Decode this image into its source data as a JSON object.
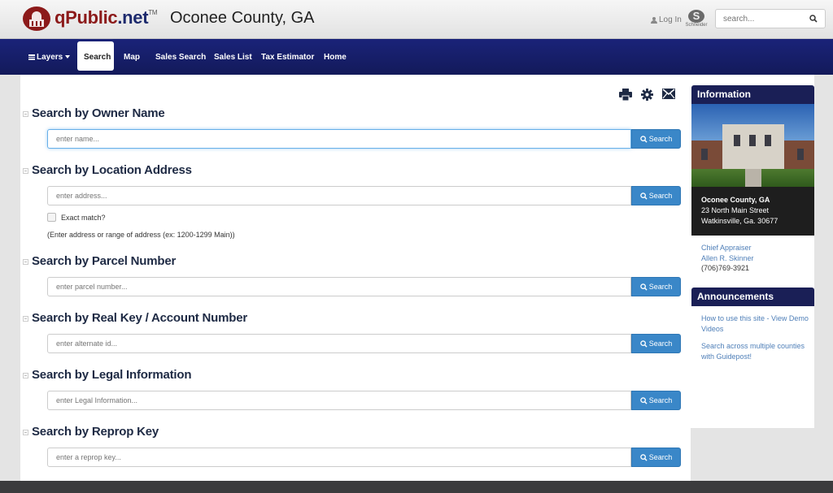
{
  "header": {
    "brand_main": "qPublic",
    "brand_ext": ".net",
    "brand_tm": "TM",
    "county": "Oconee County, GA",
    "login_label": "Log In",
    "partner_logo": "Schneider",
    "search_placeholder": "search..."
  },
  "nav": {
    "items": [
      {
        "label": "Layers",
        "icon": "layers-icon",
        "dropdown": true
      },
      {
        "label": "Search",
        "active": true
      },
      {
        "label": "Map"
      },
      {
        "label": "Sales Search"
      },
      {
        "label": "Sales List"
      },
      {
        "label": "Tax Estimator"
      },
      {
        "label": "Home"
      }
    ]
  },
  "toolbar": {
    "icons": [
      "print-icon",
      "gear-icon",
      "envelope-icon"
    ]
  },
  "search_sections": [
    {
      "title": "Search by Owner Name",
      "placeholder": "enter name...",
      "button": "Search"
    },
    {
      "title": "Search by Location Address",
      "placeholder": "enter address...",
      "button": "Search",
      "checkbox_label": "Exact match?",
      "checkbox_checked": false,
      "hint": "(Enter address or range of address (ex: 1200-1299 Main))"
    },
    {
      "title": "Search by Parcel Number",
      "placeholder": "enter parcel number...",
      "button": "Search"
    },
    {
      "title": "Search by Real Key / Account Number",
      "placeholder": "enter alternate id...",
      "button": "Search"
    },
    {
      "title": "Search by Legal Information",
      "placeholder": "enter Legal Information...",
      "button": "Search"
    },
    {
      "title": "Search by Reprop Key",
      "placeholder": "enter a reprop key...",
      "button": "Search"
    }
  ],
  "sidebar": {
    "information_title": "Information",
    "office_name": "Oconee County, GA",
    "office_street": "23 North Main Street",
    "office_city": "Watkinsville, Ga. 30677",
    "appraiser_title": "Chief Appraiser",
    "appraiser_name": "Allen R. Skinner",
    "phone": "(706)769-3921",
    "announcements_title": "Announcements",
    "announcements": [
      "How to use this site - View Demo Videos",
      "Search across multiple counties with Guidepost!"
    ]
  },
  "colors": {
    "nav_bg": "#1a2379",
    "brand_red": "#8c1a1a",
    "button_blue": "#3a87c8",
    "sidebar_head": "#1a1f56",
    "link_blue": "#4f7fb8"
  }
}
